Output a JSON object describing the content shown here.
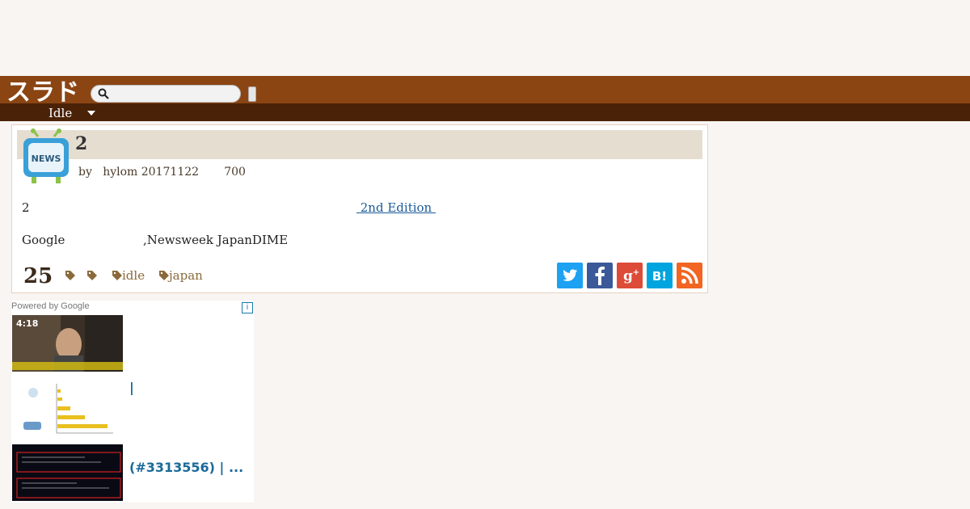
{
  "site": {
    "logo_text": "スラド",
    "brand_color": "#8b4513",
    "nav_dark": "#4a2208"
  },
  "search": {
    "placeholder": ""
  },
  "nav": {
    "label": "Idle"
  },
  "article": {
    "title": "2",
    "icon_label": "NEWS",
    "meta": "by   hylom 20171122       700",
    "para1_left": "2",
    "para1_link": " 2nd Edition ",
    "para2_left": "Google",
    "para2_mid": ",Newsweek JapanDIME",
    "comments": "25",
    "tags": [
      "",
      "",
      "idle",
      "japan"
    ]
  },
  "share": {
    "twitter": "twitter-icon",
    "facebook": "facebook-icon",
    "googleplus": "google-plus-icon",
    "hatena": "hatena-bookmark-icon",
    "rss": "rss-icon",
    "hatena_text": "B!",
    "gplus_text": "g+"
  },
  "ads": {
    "powered_by": "Powered by Google",
    "info": "i",
    "items": [
      {
        "text": ""
      },
      {
        "text": "|"
      },
      {
        "text": "(#3313556) | ..."
      }
    ],
    "thumb1_time": "4:18"
  }
}
